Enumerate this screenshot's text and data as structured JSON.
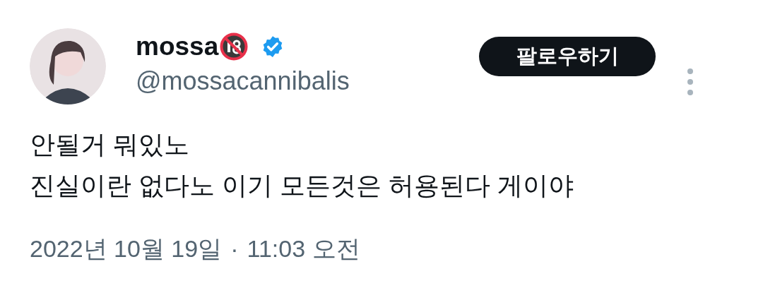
{
  "author": {
    "name": "mossa",
    "verified": true,
    "handle": "@mossacannibalis"
  },
  "follow_button": "팔로우하기",
  "tweet_lines": [
    "안될거 뭐있노",
    "진실이란 없다노 이기 모든것은 허용된다 게이야"
  ],
  "timestamp": {
    "date": "2022년 10월 19일",
    "separator": "·",
    "time": "11:03 오전"
  }
}
